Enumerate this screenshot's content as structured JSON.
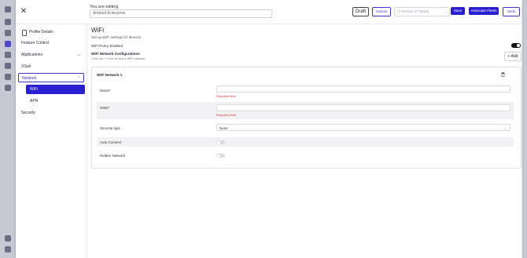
{
  "app_rail": {
    "icons": [
      "logo-icon",
      "home-icon",
      "devices-icon",
      "profiles-icon",
      "apps-icon",
      "groups-icon",
      "users-icon",
      "reports-icon",
      "settings-icon",
      "help-icon"
    ]
  },
  "header": {
    "editing_caption": "You are editing",
    "profile_name": "Android Enterprise",
    "status_badge": "Draft",
    "actions_label": "Actions",
    "version_label": "Version 27 (Draft)",
    "save_label": "Save",
    "associate_label": "Associate Fleets",
    "undo_label": "Undo"
  },
  "sidebar": {
    "items": [
      {
        "label": "Profile Details"
      },
      {
        "label": "Feature Control"
      },
      {
        "label": "Applications"
      },
      {
        "label": "XSub"
      },
      {
        "label": "Network"
      },
      {
        "label": "WiFi"
      },
      {
        "label": "APN"
      },
      {
        "label": "Security"
      }
    ]
  },
  "main": {
    "title": "WiFi",
    "subtitle": "Set up WiFi settings for devices",
    "policy_label": "WiFi Policy Enabled",
    "policy_enabled": true,
    "config_title": "WiFi Network Configurations",
    "config_hint": "Click the '+' icon to add a WiFi network",
    "add_label": "Add",
    "network": {
      "title": "WiFi Network 1",
      "fields": {
        "name_label": "Name*",
        "name_value": "",
        "name_error": "Required field",
        "ssid_label": "SSID*",
        "ssid_value": "",
        "ssid_error": "Required field",
        "security_label": "Security type",
        "security_value": "None",
        "auto_connect_label": "Auto Connect",
        "auto_connect": false,
        "hidden_label": "Hidden Network",
        "hidden": false
      }
    }
  },
  "colors": {
    "primary": "#2a1fd0",
    "error": "#d13535",
    "rail": "#c6c8d4"
  }
}
